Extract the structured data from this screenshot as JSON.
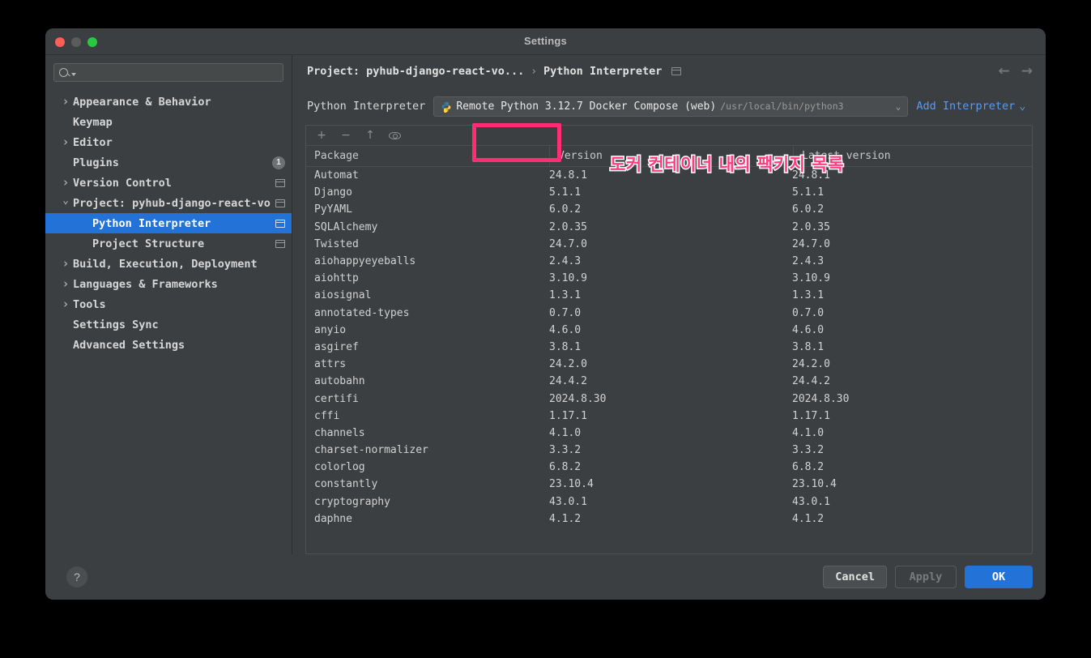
{
  "window": {
    "title": "Settings",
    "traffic_lights": [
      "close",
      "minimize",
      "maximize"
    ]
  },
  "sidebar": {
    "search": {
      "value": "",
      "placeholder": ""
    },
    "items": [
      {
        "label": "Appearance & Behavior",
        "level": 1,
        "twisty": "collapsed",
        "selected": false,
        "badge": null,
        "icon": null
      },
      {
        "label": "Keymap",
        "level": 1,
        "twisty": "none",
        "selected": false,
        "badge": null,
        "icon": null
      },
      {
        "label": "Editor",
        "level": 1,
        "twisty": "collapsed",
        "selected": false,
        "badge": null,
        "icon": null
      },
      {
        "label": "Plugins",
        "level": 1,
        "twisty": "none",
        "selected": false,
        "badge": "1",
        "icon": null
      },
      {
        "label": "Version Control",
        "level": 1,
        "twisty": "collapsed",
        "selected": false,
        "badge": null,
        "icon": "project-settings-icon"
      },
      {
        "label": "Project: pyhub-django-react-vo",
        "level": 1,
        "twisty": "expanded",
        "selected": false,
        "badge": null,
        "icon": "project-settings-icon"
      },
      {
        "label": "Python Interpreter",
        "level": 2,
        "twisty": "none",
        "selected": true,
        "badge": null,
        "icon": "project-settings-icon"
      },
      {
        "label": "Project Structure",
        "level": 2,
        "twisty": "none",
        "selected": false,
        "badge": null,
        "icon": "project-settings-icon"
      },
      {
        "label": "Build, Execution, Deployment",
        "level": 1,
        "twisty": "collapsed",
        "selected": false,
        "badge": null,
        "icon": null
      },
      {
        "label": "Languages & Frameworks",
        "level": 1,
        "twisty": "collapsed",
        "selected": false,
        "badge": null,
        "icon": null
      },
      {
        "label": "Tools",
        "level": 1,
        "twisty": "collapsed",
        "selected": false,
        "badge": null,
        "icon": null
      },
      {
        "label": "Settings Sync",
        "level": 1,
        "twisty": "none",
        "selected": false,
        "badge": null,
        "icon": null
      },
      {
        "label": "Advanced Settings",
        "level": 1,
        "twisty": "none",
        "selected": false,
        "badge": null,
        "icon": null
      }
    ]
  },
  "breadcrumb": {
    "project": "Project: pyhub-django-react-vo...",
    "separator": "›",
    "page": "Python Interpreter",
    "back_arrow": "←",
    "forward_arrow": "→"
  },
  "interpreter": {
    "label": "Python Interpreter",
    "name": "Remote Python 3.12.7 Docker Compose (web)",
    "path": "/usr/local/bin/python3",
    "caret": "⌄",
    "add_interpreter": "Add Interpreter",
    "add_caret": "⌄"
  },
  "packages": {
    "toolbar": [
      {
        "name": "add-package-icon",
        "glyph": "+"
      },
      {
        "name": "remove-package-icon",
        "glyph": "−"
      },
      {
        "name": "upgrade-package-icon",
        "glyph": "↑"
      },
      {
        "name": "show-early-releases-icon",
        "glyph": "eye"
      }
    ],
    "columns": [
      "Package",
      "Version",
      "Latest version"
    ],
    "rows": [
      {
        "package": "Automat",
        "version": "24.8.1",
        "latest": "24.8.1"
      },
      {
        "package": "Django",
        "version": "5.1.1",
        "latest": "5.1.1"
      },
      {
        "package": "PyYAML",
        "version": "6.0.2",
        "latest": "6.0.2"
      },
      {
        "package": "SQLAlchemy",
        "version": "2.0.35",
        "latest": "2.0.35"
      },
      {
        "package": "Twisted",
        "version": "24.7.0",
        "latest": "24.7.0"
      },
      {
        "package": "aiohappyeyeballs",
        "version": "2.4.3",
        "latest": "2.4.3"
      },
      {
        "package": "aiohttp",
        "version": "3.10.9",
        "latest": "3.10.9"
      },
      {
        "package": "aiosignal",
        "version": "1.3.1",
        "latest": "1.3.1"
      },
      {
        "package": "annotated-types",
        "version": "0.7.0",
        "latest": "0.7.0"
      },
      {
        "package": "anyio",
        "version": "4.6.0",
        "latest": "4.6.0"
      },
      {
        "package": "asgiref",
        "version": "3.8.1",
        "latest": "3.8.1"
      },
      {
        "package": "attrs",
        "version": "24.2.0",
        "latest": "24.2.0"
      },
      {
        "package": "autobahn",
        "version": "24.4.2",
        "latest": "24.4.2"
      },
      {
        "package": "certifi",
        "version": "2024.8.30",
        "latest": "2024.8.30"
      },
      {
        "package": "cffi",
        "version": "1.17.1",
        "latest": "1.17.1"
      },
      {
        "package": "channels",
        "version": "4.1.0",
        "latest": "4.1.0"
      },
      {
        "package": "charset-normalizer",
        "version": "3.3.2",
        "latest": "3.3.2"
      },
      {
        "package": "colorlog",
        "version": "6.8.2",
        "latest": "6.8.2"
      },
      {
        "package": "constantly",
        "version": "23.10.4",
        "latest": "23.10.4"
      },
      {
        "package": "cryptography",
        "version": "43.0.1",
        "latest": "43.0.1"
      },
      {
        "package": "daphne",
        "version": "4.1.2",
        "latest": "4.1.2"
      }
    ]
  },
  "footer": {
    "help": "?",
    "cancel": "Cancel",
    "apply": "Apply",
    "ok": "OK"
  },
  "annotations": {
    "korean_note": "도커 컨테이너 내의 팩키지 목록",
    "highlight_color": "#ff2d72",
    "note_color": "#ff3d7f"
  }
}
